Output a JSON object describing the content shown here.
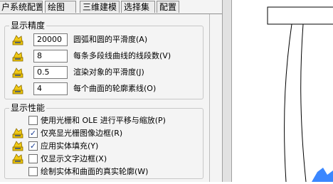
{
  "tabs": [
    "户系统配置",
    "绘图",
    "三维建模",
    "选择集",
    "配置"
  ],
  "display_precision": {
    "title": "显示精度",
    "rows": [
      {
        "value": "20000",
        "label": "圆弧和圆的平滑度(A)"
      },
      {
        "value": "8",
        "label": "每条多段线曲线的线段数(V)"
      },
      {
        "value": "0.5",
        "label": "渲染对象的平滑度(J)"
      },
      {
        "value": "4",
        "label": "每个曲面的轮廓素线(O)"
      }
    ]
  },
  "display_performance": {
    "title": "显示性能",
    "rows": [
      {
        "label": "使用光栅和 OLE 进行平移与缩放(P)",
        "checked": false,
        "icon": false
      },
      {
        "label": "仅亮显光栅图像边框(R)",
        "checked": true,
        "icon": true
      },
      {
        "label": "应用实体填充(Y)",
        "checked": true,
        "icon": true
      },
      {
        "label": "仅显示文字边框(X)",
        "checked": false,
        "icon": true
      },
      {
        "label": "绘制实体和曲面的真实轮廓(W)",
        "checked": false,
        "icon": false
      }
    ]
  },
  "colors": {
    "accent": "#1c3f95",
    "icon_yellow": "#e8c000",
    "canvas_blue": "#3b87ff"
  }
}
